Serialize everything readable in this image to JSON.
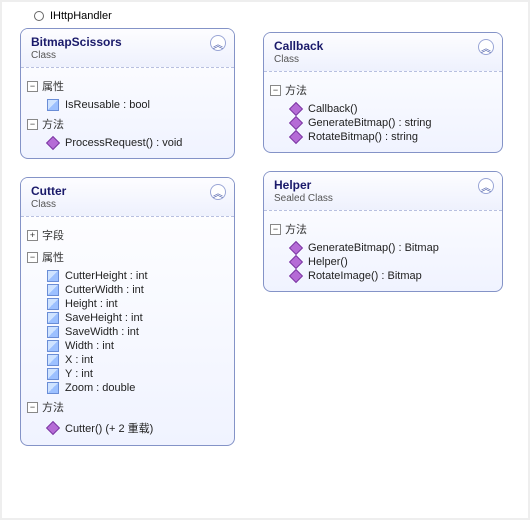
{
  "interface": {
    "name": "IHttpHandler"
  },
  "classes": {
    "bitmapScissors": {
      "title": "BitmapScissors",
      "subtitle": "Class",
      "sections": {
        "props": {
          "label": "属性",
          "members": [
            "IsReusable : bool"
          ]
        },
        "methods": {
          "label": "方法",
          "members": [
            "ProcessRequest() : void"
          ]
        }
      }
    },
    "callback": {
      "title": "Callback",
      "subtitle": "Class",
      "sections": {
        "methods": {
          "label": "方法",
          "members": [
            "Callback()",
            "GenerateBitmap() : string",
            "RotateBitmap() : string"
          ]
        }
      }
    },
    "cutter": {
      "title": "Cutter",
      "subtitle": "Class",
      "sections": {
        "fields": {
          "label": "字段"
        },
        "props": {
          "label": "属性",
          "members": [
            "CutterHeight : int",
            "CutterWidth : int",
            "Height : int",
            "SaveHeight : int",
            "SaveWidth : int",
            "Width : int",
            "X : int",
            "Y : int",
            "Zoom : double"
          ]
        },
        "methods": {
          "label": "方法",
          "members": [
            "Cutter() (+ 2 重载)"
          ]
        }
      }
    },
    "helper": {
      "title": "Helper",
      "subtitle": "Sealed Class",
      "sections": {
        "methods": {
          "label": "方法",
          "members": [
            "GenerateBitmap() : Bitmap",
            "Helper()",
            "RotateImage() : Bitmap"
          ]
        }
      }
    }
  },
  "glyphs": {
    "minus": "−",
    "plus": "+",
    "chevronUp": "︽"
  }
}
